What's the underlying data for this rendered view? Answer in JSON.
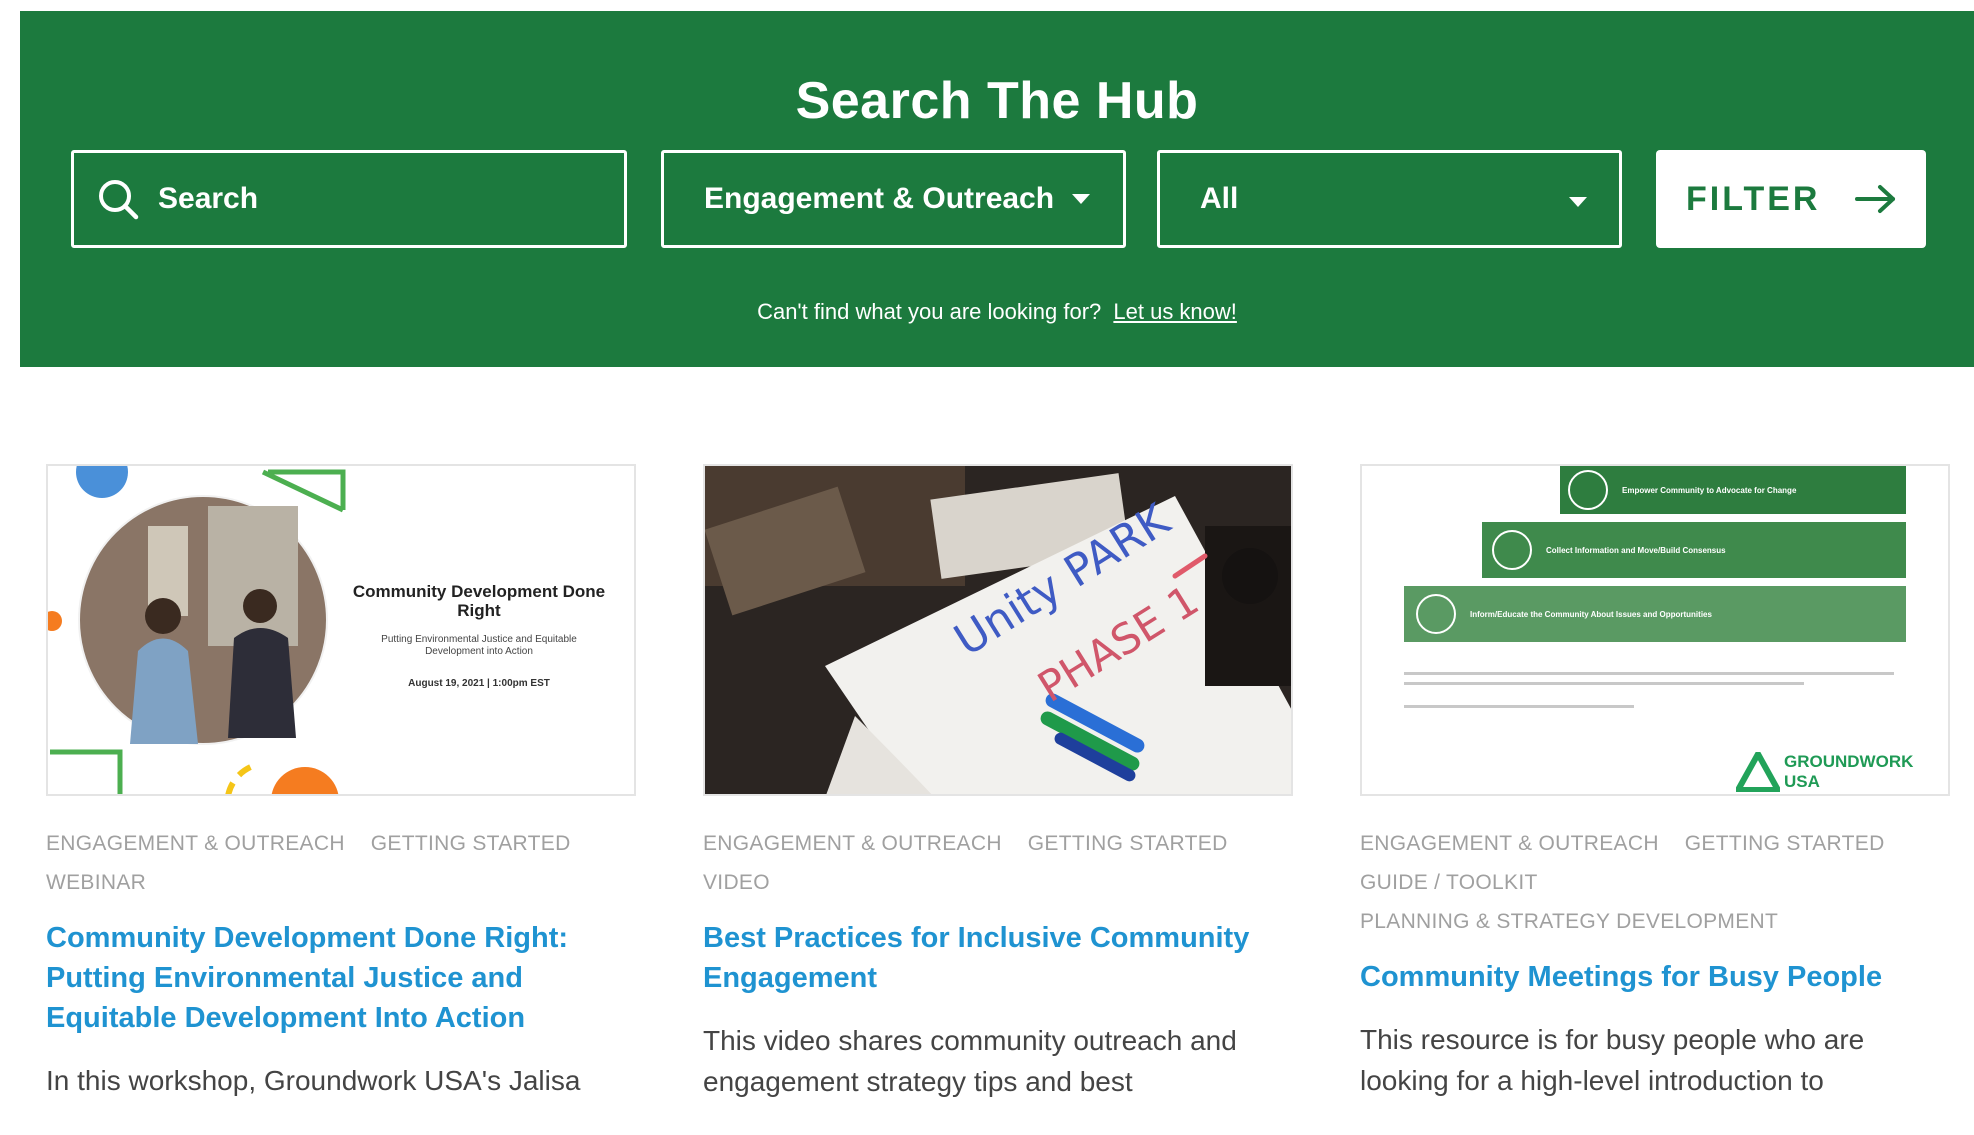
{
  "hero": {
    "title": "Search The Hub",
    "search_placeholder": "Search",
    "category_selected": "Engagement & Outreach",
    "type_selected": "All",
    "filter_label": "FILTER",
    "help_text": "Can't find what you are looking for?",
    "help_link": "Let us know!"
  },
  "colors": {
    "brand_green": "#1c7a3e",
    "link_blue": "#1f93d1",
    "tag_gray": "#a0a0a0"
  },
  "cards": [
    {
      "tags_line1": [
        "ENGAGEMENT & OUTREACH",
        "GETTING STARTED"
      ],
      "tags_line2": [
        "WEBINAR"
      ],
      "title": "Community Development Done Right: Putting Environmental Justice and Equitable Development Into Action",
      "description": "In this workshop, Groundwork USA's Jalisa",
      "thumb": {
        "heading": "Community Development Done Right",
        "subheading": "Putting Environmental Justice and Equitable Development into Action",
        "date": "August 19, 2021 | 1:00pm EST"
      }
    },
    {
      "tags_line1": [
        "ENGAGEMENT & OUTREACH",
        "GETTING STARTED"
      ],
      "tags_line2": [
        "VIDEO"
      ],
      "title": "Best Practices for Inclusive Community Engagement",
      "description": "This video shares community outreach and engagement strategy tips and best",
      "thumb": {
        "line1": "Unity PARK",
        "line2": "PHASE 1"
      }
    },
    {
      "tags_line1": [
        "ENGAGEMENT & OUTREACH",
        "GETTING STARTED"
      ],
      "tags_line2": [
        "GUIDE / TOOLKIT"
      ],
      "tags_line3": [
        "PLANNING & STRATEGY DEVELOPMENT"
      ],
      "title": "Community Meetings for Busy People",
      "description": "This resource is for busy people who are looking for a high-level introduction to",
      "thumb": {
        "step1": "Empower Community to Advocate for Change",
        "step2": "Collect Information and Move/Build Consensus",
        "step3": "Inform/Educate the Community About Issues and Opportunities",
        "logo_line1": "GROUNDWORK",
        "logo_line2": "USA"
      }
    }
  ]
}
